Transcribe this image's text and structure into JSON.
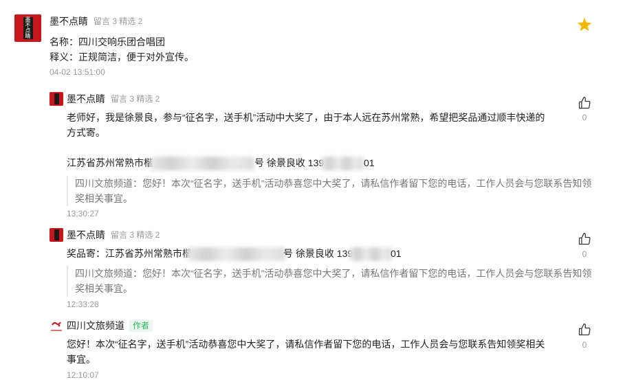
{
  "main_comment": {
    "avatar_text": [
      "墨",
      "不",
      "点",
      "睛"
    ],
    "username": "墨不点睛",
    "stats": "留言 3 精选 2",
    "line1": "名称：四川交响乐团合唱团",
    "line2": "释义：正规简洁，便于对外宣传。",
    "time": "04-02 13:51:00",
    "star_color": "#f5b800"
  },
  "replies": [
    {
      "username": "墨不点睛",
      "stats": "留言 3 精选 2",
      "text_line1": "老师好，我是徐景良，参与“征名字，送手机”活动中大奖了，由于本人远在苏州常熟，希望把奖品通过顺丰快递的",
      "text_line2": "方式寄。",
      "address_a": "江苏省苏州常熟市楷",
      "address_b": "号  徐景良收  139",
      "address_c": "01",
      "quote_line1": "四川文旅频道：您好！本次“征名字，送手机”活动恭喜您中大奖了，请私信作者留下您的电话，工作人员会与您联系告知领",
      "quote_line2": "奖相关事宜。",
      "time": "13:30:27",
      "likes": "0"
    },
    {
      "username": "墨不点睛",
      "stats": "留言 3 精选 2",
      "address_a": "奖品寄：江苏省苏州常熟市楷",
      "address_b": "号  徐景良收  139",
      "address_c": "01",
      "quote_line1": "四川文旅频道：您好！本次“征名字，送手机”活动恭喜您中大奖了，请私信作者留下您的电话，工作人员会与您联系告知领",
      "quote_line2": "奖相关事宜。",
      "time": "12:33:28",
      "likes": "0"
    },
    {
      "username": "四川文旅频道",
      "badge": "作者",
      "text_line1": "您好！本次“征名字，送手机”活动恭喜您中大奖了，请私信作者留下您的电话，工作人员会与您联系告知领奖相关",
      "text_line2": "事宜。",
      "time": "12:10:07",
      "likes": "0"
    }
  ]
}
